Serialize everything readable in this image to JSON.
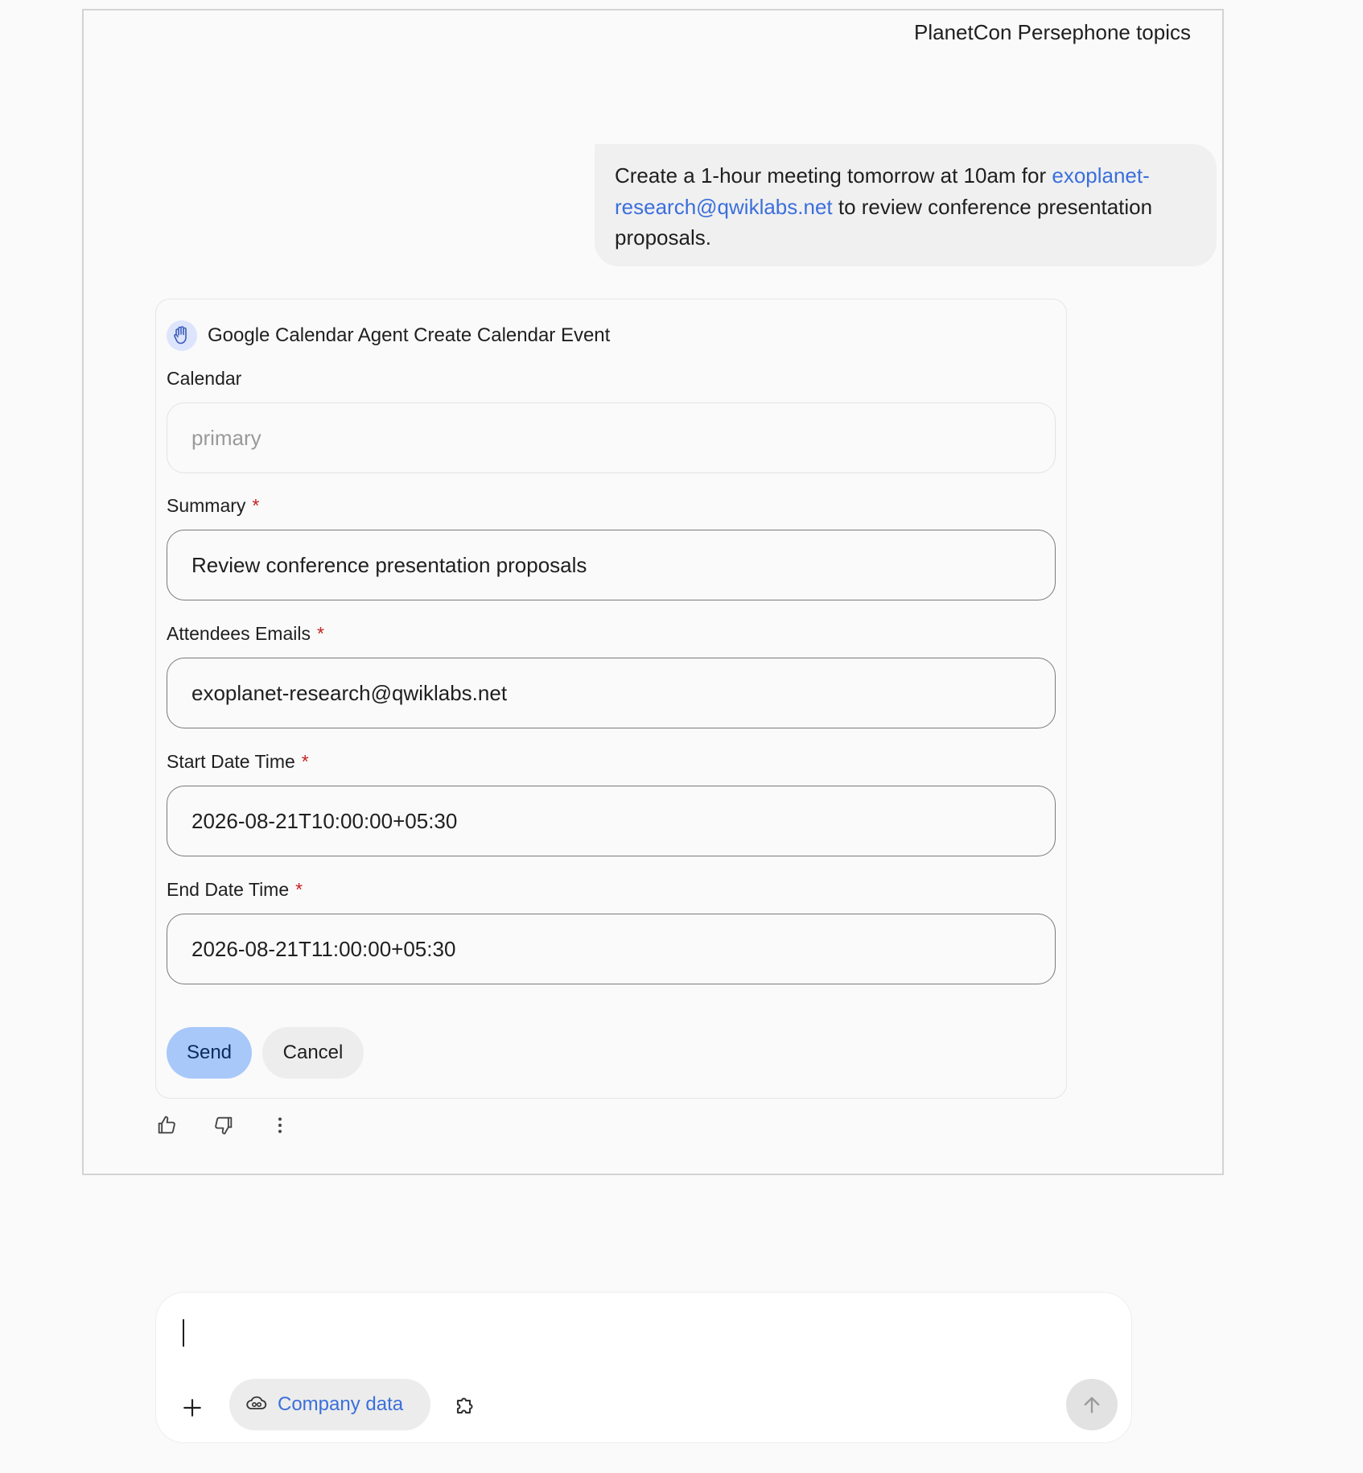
{
  "conversation": {
    "title": "PlanetCon Persephone topics"
  },
  "user_message": {
    "text_before": "Create a 1-hour meeting tomorrow at 10am for ",
    "link_text": "exoplanet-research@qwiklabs.net",
    "text_after": " to review conference presentation proposals."
  },
  "tool_card": {
    "icon": "raised-hand-icon",
    "title": "Google Calendar Agent Create Calendar Event",
    "fields": {
      "calendar": {
        "label": "Calendar",
        "placeholder": "primary",
        "value": "",
        "required": false
      },
      "summary": {
        "label": "Summary",
        "value": "Review conference presentation proposals",
        "required": true
      },
      "attendees": {
        "label": "Attendees Emails",
        "value": "exoplanet-research@qwiklabs.net",
        "required": true
      },
      "start": {
        "label": "Start Date Time",
        "value": "2026-08-21T10:00:00+05:30",
        "required": true
      },
      "end": {
        "label": "End Date Time",
        "value": "2026-08-21T11:00:00+05:30",
        "required": true
      }
    },
    "required_marker": "*",
    "send_label": "Send",
    "cancel_label": "Cancel"
  },
  "feedback": {
    "like_icon": "thumbs-up-icon",
    "dislike_icon": "thumbs-down-icon",
    "more_icon": "more-vert-icon"
  },
  "composer": {
    "input_value": "",
    "add_icon": "plus-icon",
    "company_chip_icon": "cloud-link-icon",
    "company_chip_label": "Company data",
    "tools_icon": "puzzle-icon",
    "submit_icon": "arrow-up-icon"
  },
  "colors": {
    "link": "#3b6fdc",
    "send_button": "#a8c8fa",
    "required_marker": "#c5221f",
    "bubble": "#f0f0f0"
  }
}
